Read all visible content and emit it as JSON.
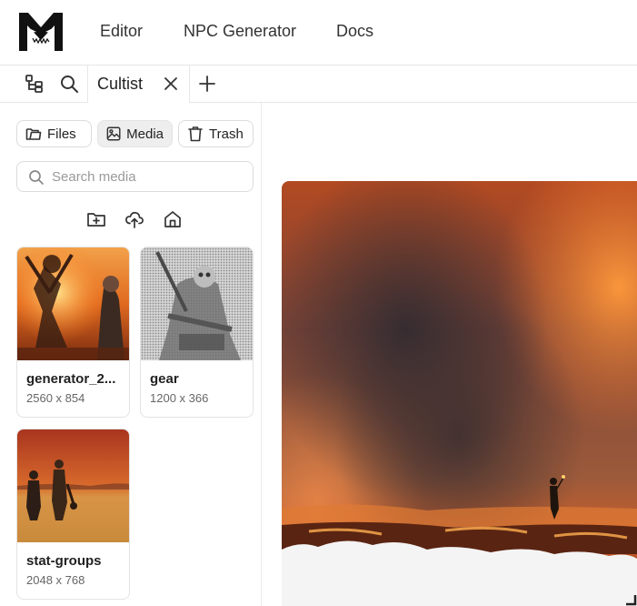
{
  "nav": {
    "links": [
      "Editor",
      "NPC Generator",
      "Docs"
    ]
  },
  "tabs": {
    "active_label": "Cultist"
  },
  "sidebar": {
    "segments": [
      {
        "label": "Files",
        "icon": "folder-icon",
        "active": false
      },
      {
        "label": "Media",
        "icon": "image-icon",
        "active": true
      },
      {
        "label": "Trash",
        "icon": "trash-icon",
        "active": false
      }
    ],
    "search_placeholder": "Search media",
    "actions": [
      "new-folder-icon",
      "upload-icon",
      "home-icon"
    ],
    "media": [
      {
        "name": "generator_2...",
        "dims": "2560 x 854"
      },
      {
        "name": "gear",
        "dims": "1200 x 366"
      },
      {
        "name": "stat-groups",
        "dims": "2048 x 768"
      }
    ]
  },
  "colors": {
    "border": "#e3e3e3",
    "active_segment": "#eeeeee",
    "fire_orange": "#d9622a"
  }
}
